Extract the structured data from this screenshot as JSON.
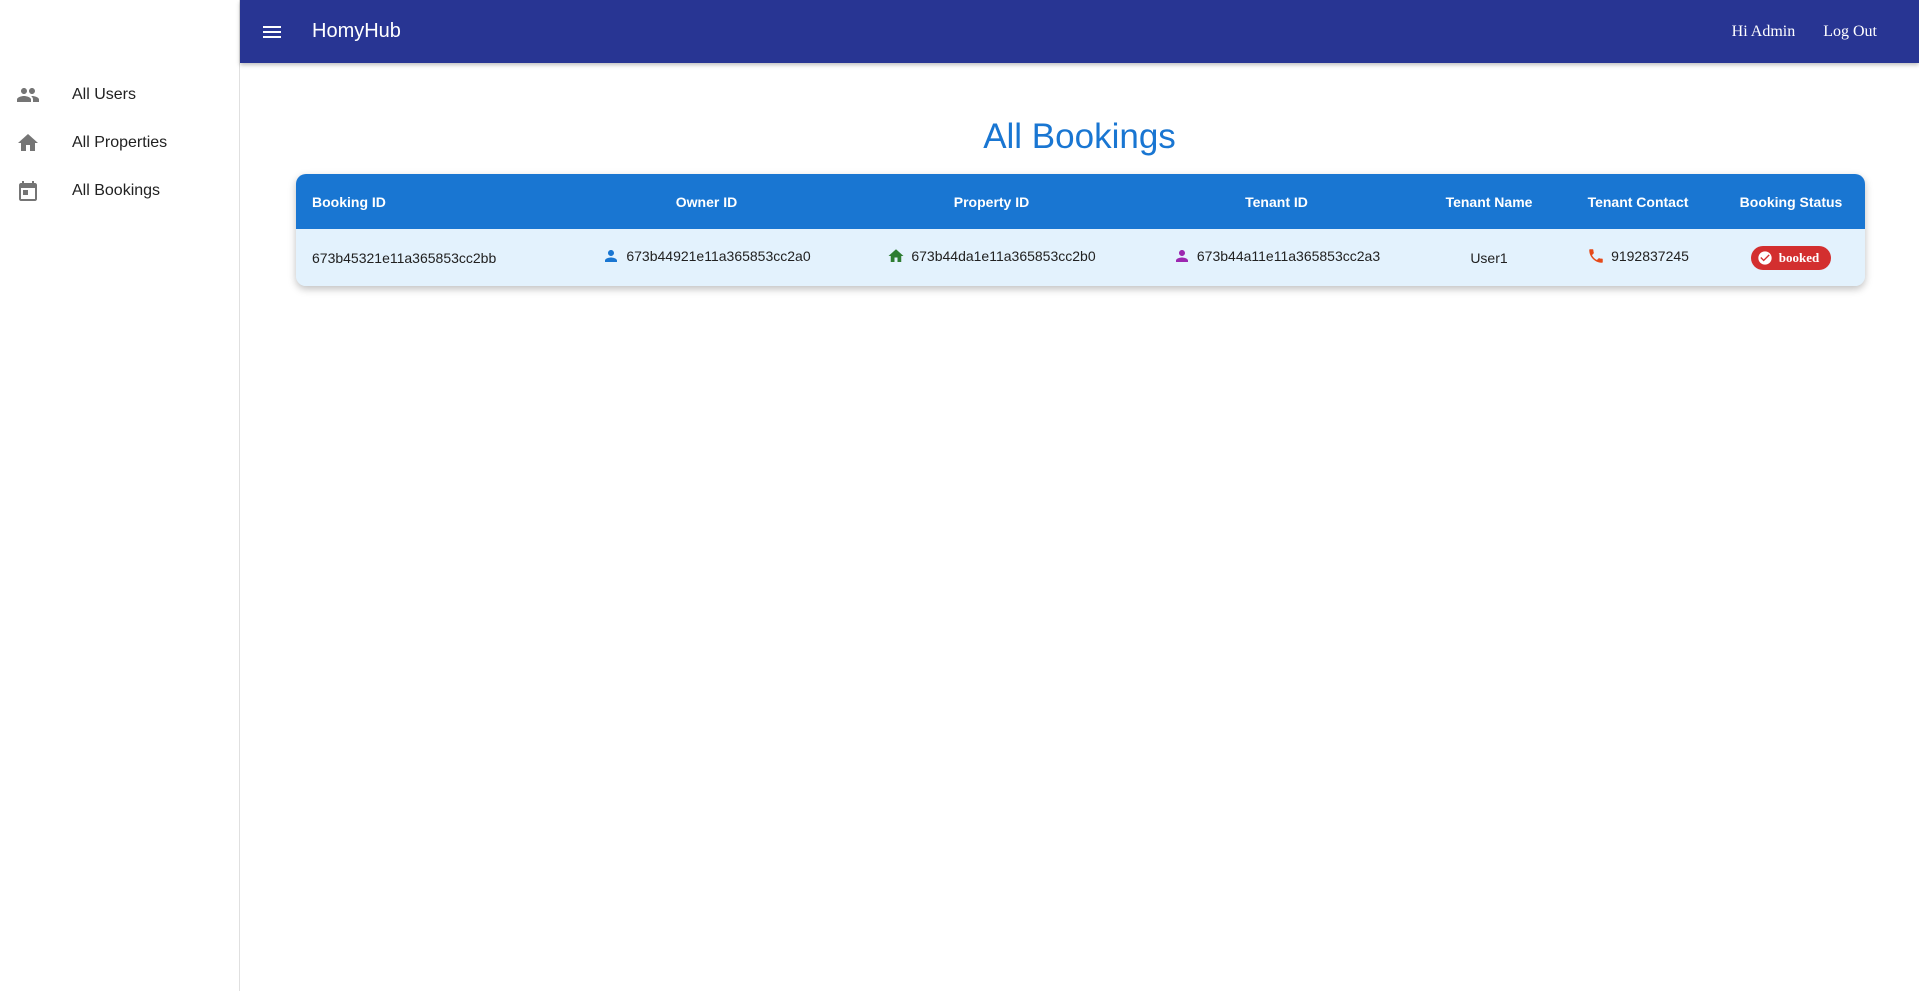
{
  "app": {
    "title": "HomyHub",
    "greeting": "Hi Admin",
    "logout_label": "Log Out"
  },
  "colors": {
    "appbar": "#283593",
    "accent": "#1976d2",
    "row_bg": "#e3f2fd",
    "status_booked": "#d32f2f",
    "owner_icon": "#1976d2",
    "property_icon": "#2e7d32",
    "tenant_icon": "#9c27b0",
    "phone_icon": "#e64a19"
  },
  "sidebar": {
    "items": [
      {
        "label": "All Users",
        "icon": "people-icon"
      },
      {
        "label": "All Properties",
        "icon": "home-icon"
      },
      {
        "label": "All Bookings",
        "icon": "calendar-icon"
      }
    ]
  },
  "page": {
    "title": "All Bookings"
  },
  "table": {
    "headers": [
      "Booking ID",
      "Owner ID",
      "Property ID",
      "Tenant ID",
      "Tenant Name",
      "Tenant Contact",
      "Booking Status"
    ],
    "rows": [
      {
        "booking_id": "673b45321e11a365853cc2bb",
        "owner_id": "673b44921e11a365853cc2a0",
        "property_id": "673b44da1e11a365853cc2b0",
        "tenant_id": "673b44a11e11a365853cc2a3",
        "tenant_name": "User1",
        "tenant_contact": "9192837245",
        "status": "booked"
      }
    ]
  }
}
